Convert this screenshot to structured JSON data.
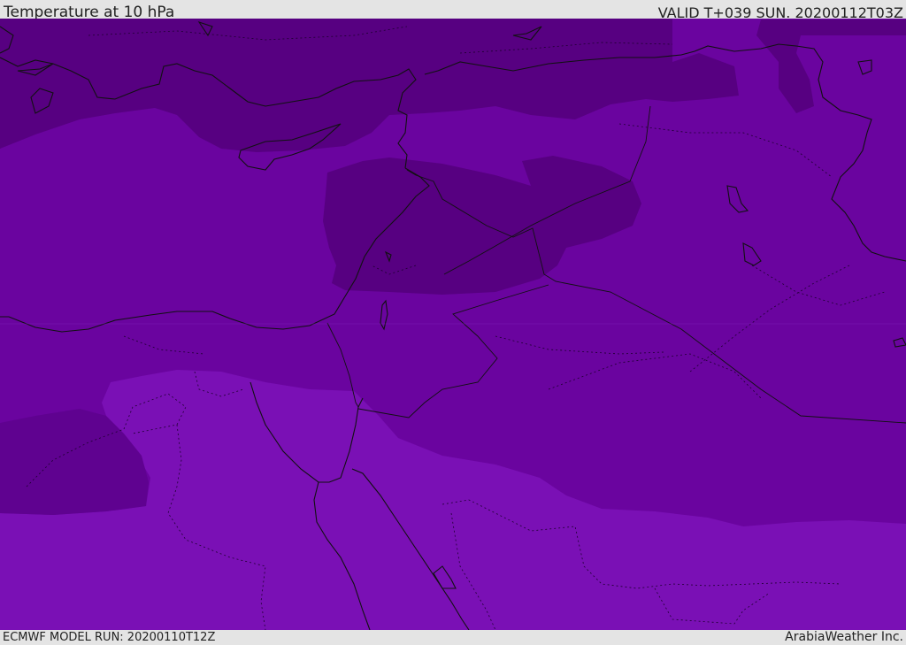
{
  "header": {
    "title": "Temperature at 10 hPa",
    "valid_time": "VALID T+039 SUN. 20200112T03Z"
  },
  "footer": {
    "model_run": "ECMWF MODEL RUN: 20200110T12Z",
    "credit": "ArabiaWeather Inc."
  },
  "map": {
    "colors": {
      "dark_band": "#570081",
      "mid_band": "#6a049f",
      "light_band": "#7a10b5",
      "coastline": "#111111",
      "borders": "#222222"
    }
  }
}
